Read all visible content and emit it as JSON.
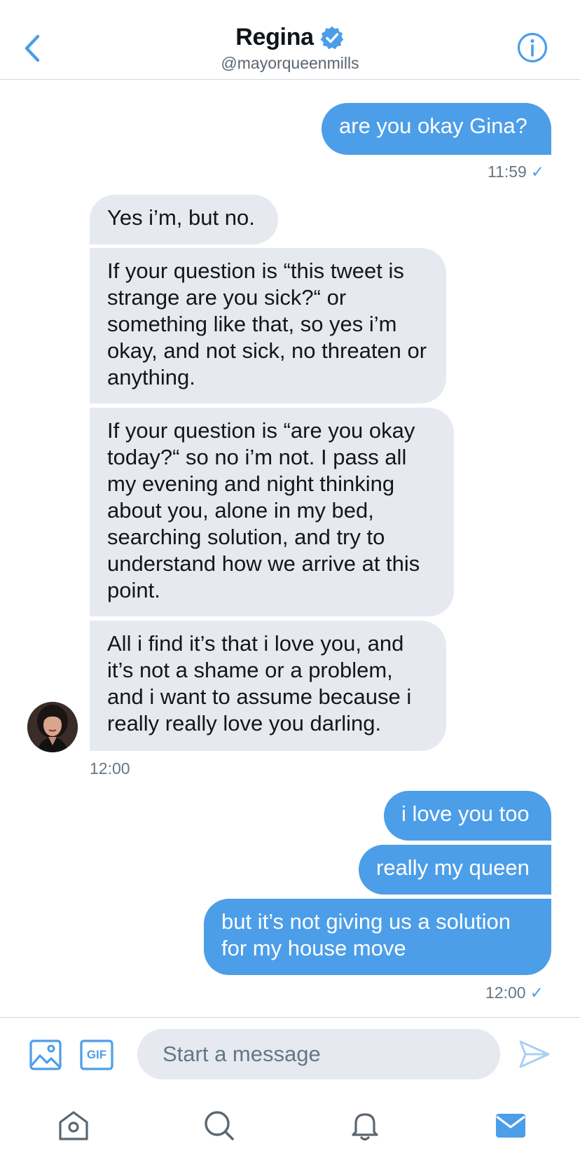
{
  "header": {
    "name": "Regina",
    "handle": "@mayorqueenmills"
  },
  "messages": [
    {
      "direction": "out",
      "text": "are you okay Gina?"
    },
    {
      "direction": "in",
      "text": "Yes i’m, but no."
    },
    {
      "direction": "in",
      "text": "If your question is “this tweet is strange are you sick?“ or something like that, so yes i’m okay, and not sick, no threaten or anything."
    },
    {
      "direction": "in",
      "text": "If your question is “are you okay today?“ so no i’m not. I pass all my evening and night thinking about you, alone in my bed, searching solution, and try to understand how we arrive at this point."
    },
    {
      "direction": "in",
      "text": "All i find it’s that i love you, and it’s not a shame or a problem, and i want to assume because i really really love you darling."
    },
    {
      "direction": "out",
      "text": "i love you too"
    },
    {
      "direction": "out",
      "text": "really my queen"
    },
    {
      "direction": "out",
      "text": "but it’s not giving us a solution for my house move"
    }
  ],
  "timestamps": {
    "first_out": "11:59",
    "in_group": "12:00",
    "last_out": "12:00",
    "read_mark": "✓"
  },
  "composer": {
    "placeholder": "Start a message",
    "gif_label": "GIF"
  },
  "icons": {
    "back": "chevron-left-icon",
    "info": "info-icon",
    "verified": "verified-badge-icon",
    "image": "image-icon",
    "gif": "gif-icon",
    "send": "send-icon",
    "home": "home-icon",
    "search": "search-icon",
    "notifications": "bell-icon",
    "messages": "mail-icon"
  },
  "colors": {
    "accent": "#4c9ee8",
    "incoming_bubble": "#e6e9ef",
    "muted_text": "#657786"
  }
}
